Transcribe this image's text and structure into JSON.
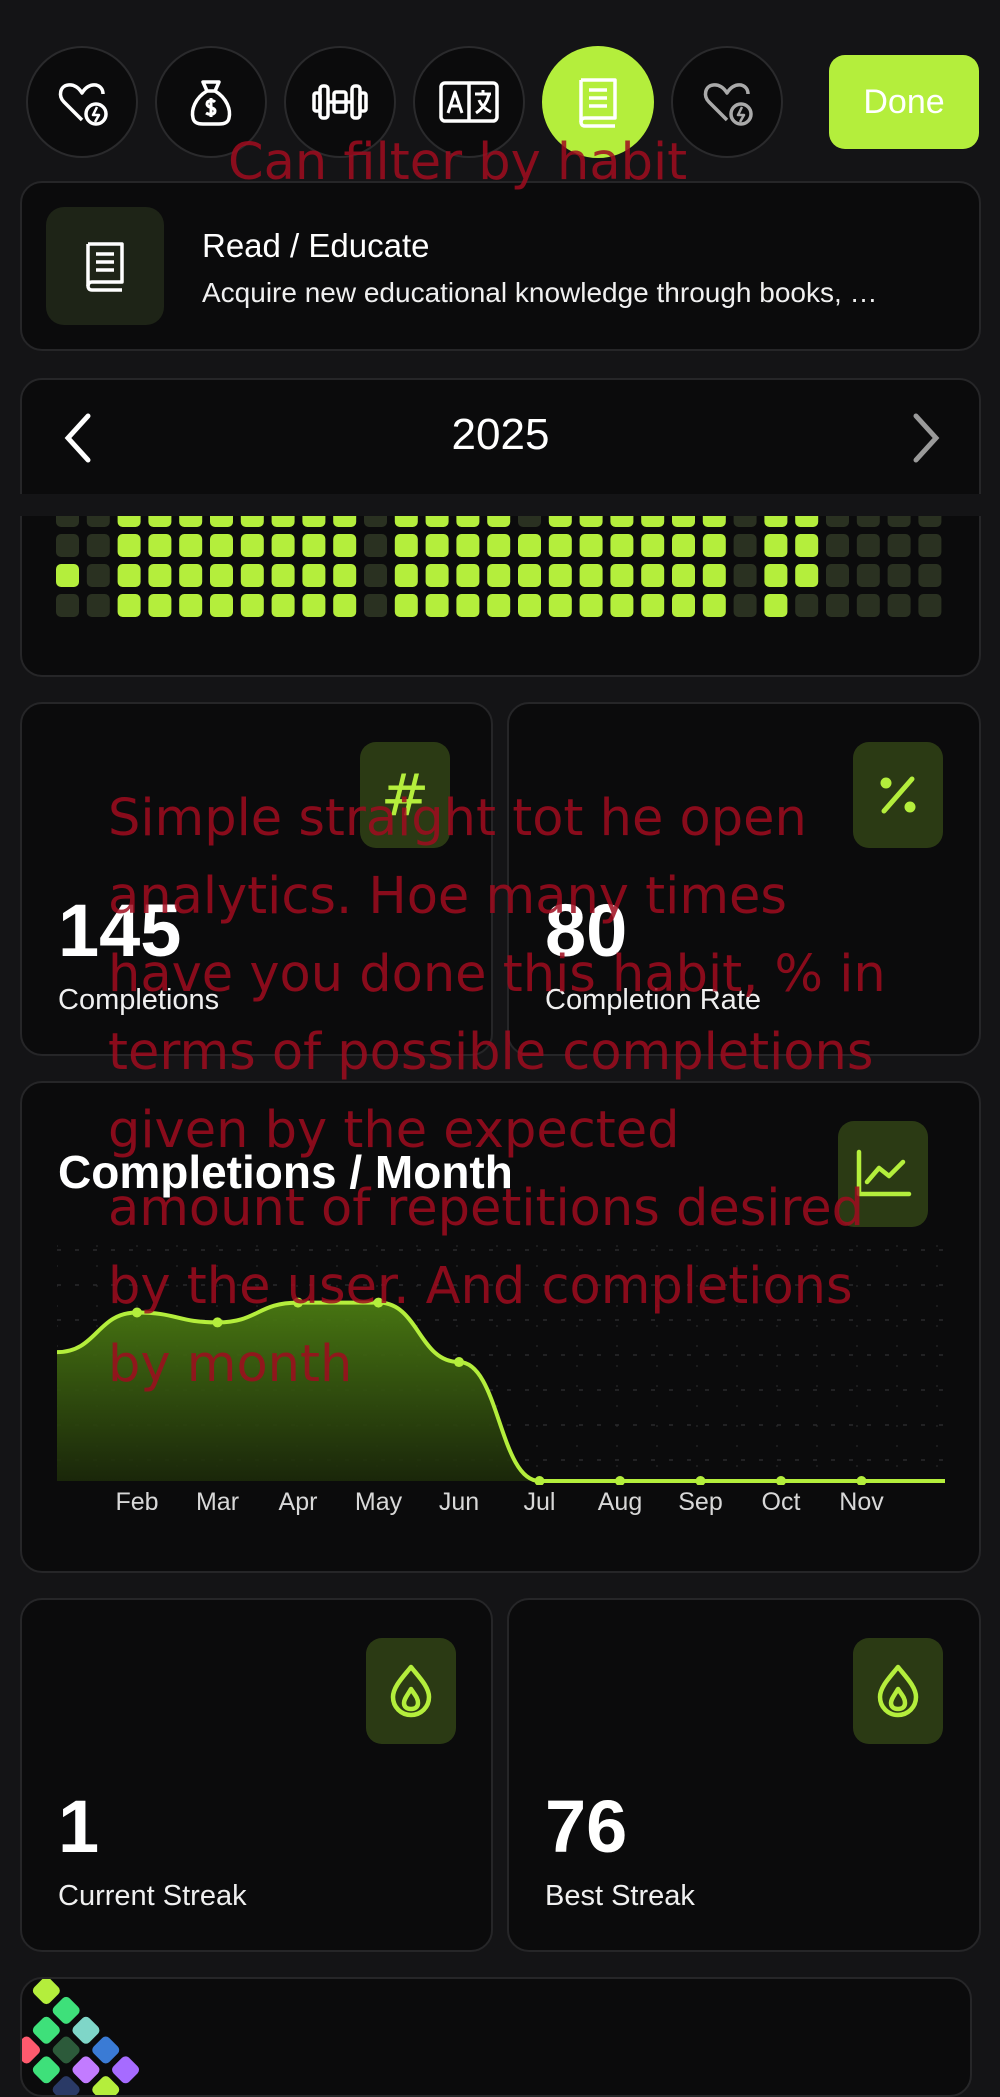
{
  "habit_bar": {
    "done_label": "Done",
    "habits": [
      {
        "icon": "heart-bolt-icon",
        "active": false
      },
      {
        "icon": "money-bag-icon",
        "active": false
      },
      {
        "icon": "dumbbell-icon",
        "active": false
      },
      {
        "icon": "translate-icon",
        "active": false
      },
      {
        "icon": "book-icon",
        "active": true
      },
      {
        "icon": "heart-bolt-icon",
        "active": false
      }
    ]
  },
  "habit": {
    "title": "Read / Educate",
    "description": "Acquire new educational knowledge through books, …",
    "icon": "book-icon"
  },
  "year_selector": {
    "year": "2025"
  },
  "stats": {
    "completions": {
      "value": "145",
      "label": "Completions",
      "icon": "hash-icon"
    },
    "completion_rate": {
      "value": "80",
      "label": "Completion Rate",
      "icon": "percent-icon"
    },
    "current_streak": {
      "value": "1",
      "label": "Current Streak",
      "icon": "flame-icon"
    },
    "best_streak": {
      "value": "76",
      "label": "Best Streak",
      "icon": "flame-icon"
    }
  },
  "chart_title": "Completions / Month",
  "chart_data": {
    "type": "area",
    "categories": [
      "Feb",
      "Mar",
      "Apr",
      "May",
      "Jun",
      "Jul",
      "Aug",
      "Sep",
      "Oct",
      "Nov"
    ],
    "values": [
      17,
      16,
      18,
      18,
      12,
      0,
      0,
      0,
      0,
      0
    ],
    "start_value": 13,
    "end_value": 0,
    "ylim": [
      0,
      25
    ],
    "grid": true,
    "color": "#b4ee3c"
  },
  "annotations": {
    "filter_note": "Can filter by habit",
    "analytics_note": [
      "Simple straight tot he open",
      "analytics. Hoe many times",
      "have you done this habit, % in",
      "terms of possible completions",
      "given by the expected",
      "amount of repetitions desired",
      "by the user. And completions",
      "by month"
    ]
  },
  "colors": {
    "accent": "#b4ee3c",
    "accent_dark": "#2b3a14",
    "cell_empty": "#2a3121",
    "background": "#141416",
    "card": "#0b0b0c"
  }
}
